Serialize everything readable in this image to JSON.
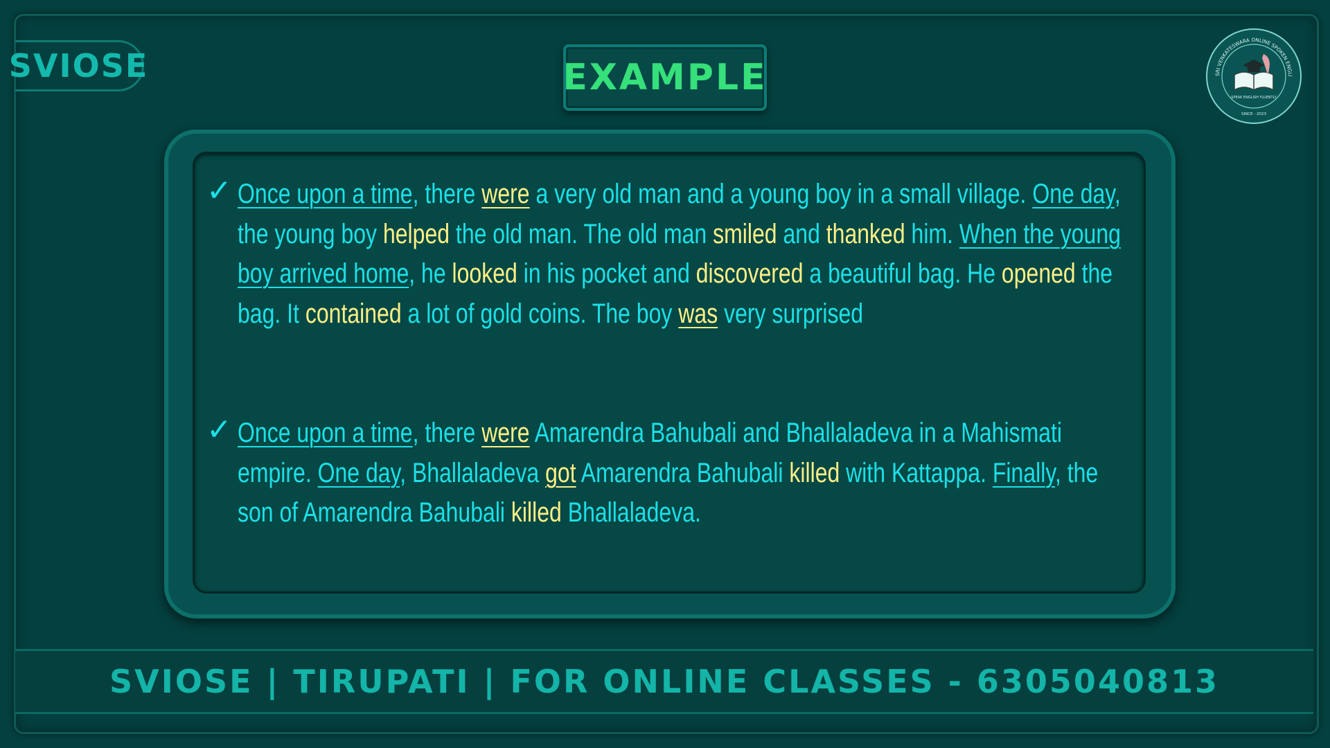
{
  "brand_tab": "SVIOSE",
  "title": "EXAMPLE",
  "logo": {
    "icon": "school-seal-book-graduation-cap-icon",
    "ring_text": "SRI VENKATESWARA ONLINE SPOKEN ENGLISH SCHOOL",
    "tagline": "SPEAK ENGLISH FLUENTLY",
    "since": "SINCE - 2023"
  },
  "check_icon": "✓",
  "paragraphs": [
    {
      "segments": [
        {
          "t": "Once upon a time",
          "s": "u"
        },
        {
          "t": ", there ",
          "s": ""
        },
        {
          "t": "were",
          "s": "uh"
        },
        {
          "t": " a very old man and a young boy in a small village. ",
          "s": ""
        },
        {
          "t": "One day",
          "s": "u"
        },
        {
          "t": ", the young boy ",
          "s": ""
        },
        {
          "t": "helped",
          "s": "h"
        },
        {
          "t": " the old man. The old man ",
          "s": ""
        },
        {
          "t": "smiled",
          "s": "h"
        },
        {
          "t": " and ",
          "s": ""
        },
        {
          "t": "thanked",
          "s": "h"
        },
        {
          "t": " him. ",
          "s": ""
        },
        {
          "t": "When the young boy arrived home",
          "s": "u"
        },
        {
          "t": ", he ",
          "s": ""
        },
        {
          "t": "looked",
          "s": "h"
        },
        {
          "t": " in his pocket and ",
          "s": ""
        },
        {
          "t": "discovered",
          "s": "h"
        },
        {
          "t": " a beautiful bag. He ",
          "s": ""
        },
        {
          "t": "opened",
          "s": "h"
        },
        {
          "t": " the bag. It ",
          "s": ""
        },
        {
          "t": "contained",
          "s": "h"
        },
        {
          "t": " a lot of gold coins. The boy ",
          "s": ""
        },
        {
          "t": "was",
          "s": "uh"
        },
        {
          "t": " very surprised",
          "s": ""
        }
      ]
    },
    {
      "segments": [
        {
          "t": "Once upon a time",
          "s": "u"
        },
        {
          "t": ", there ",
          "s": ""
        },
        {
          "t": "were",
          "s": "uh"
        },
        {
          "t": " Amarendra Bahubali and Bhallaladeva in a Mahismati empire. ",
          "s": ""
        },
        {
          "t": "One day",
          "s": "u"
        },
        {
          "t": ", Bhallaladeva ",
          "s": ""
        },
        {
          "t": "got",
          "s": "uh"
        },
        {
          "t": " Amarendra Bahubali ",
          "s": ""
        },
        {
          "t": "killed",
          "s": "h"
        },
        {
          "t": " with Kattappa. ",
          "s": ""
        },
        {
          "t": "Finally",
          "s": "u"
        },
        {
          "t": ", the son of Amarendra Bahubali ",
          "s": ""
        },
        {
          "t": "killed",
          "s": "h"
        },
        {
          "t": " Bhallaladeva.",
          "s": ""
        }
      ]
    }
  ],
  "footer": "SVIOSE | TIRUPATI | FOR ONLINE CLASSES - 6305040813",
  "colors": {
    "background": "#04403f",
    "text_cyan": "#1ce0e8",
    "highlight_yellow": "#ffef86",
    "title_green": "#36e07a",
    "brand_teal": "#14b9ad"
  }
}
